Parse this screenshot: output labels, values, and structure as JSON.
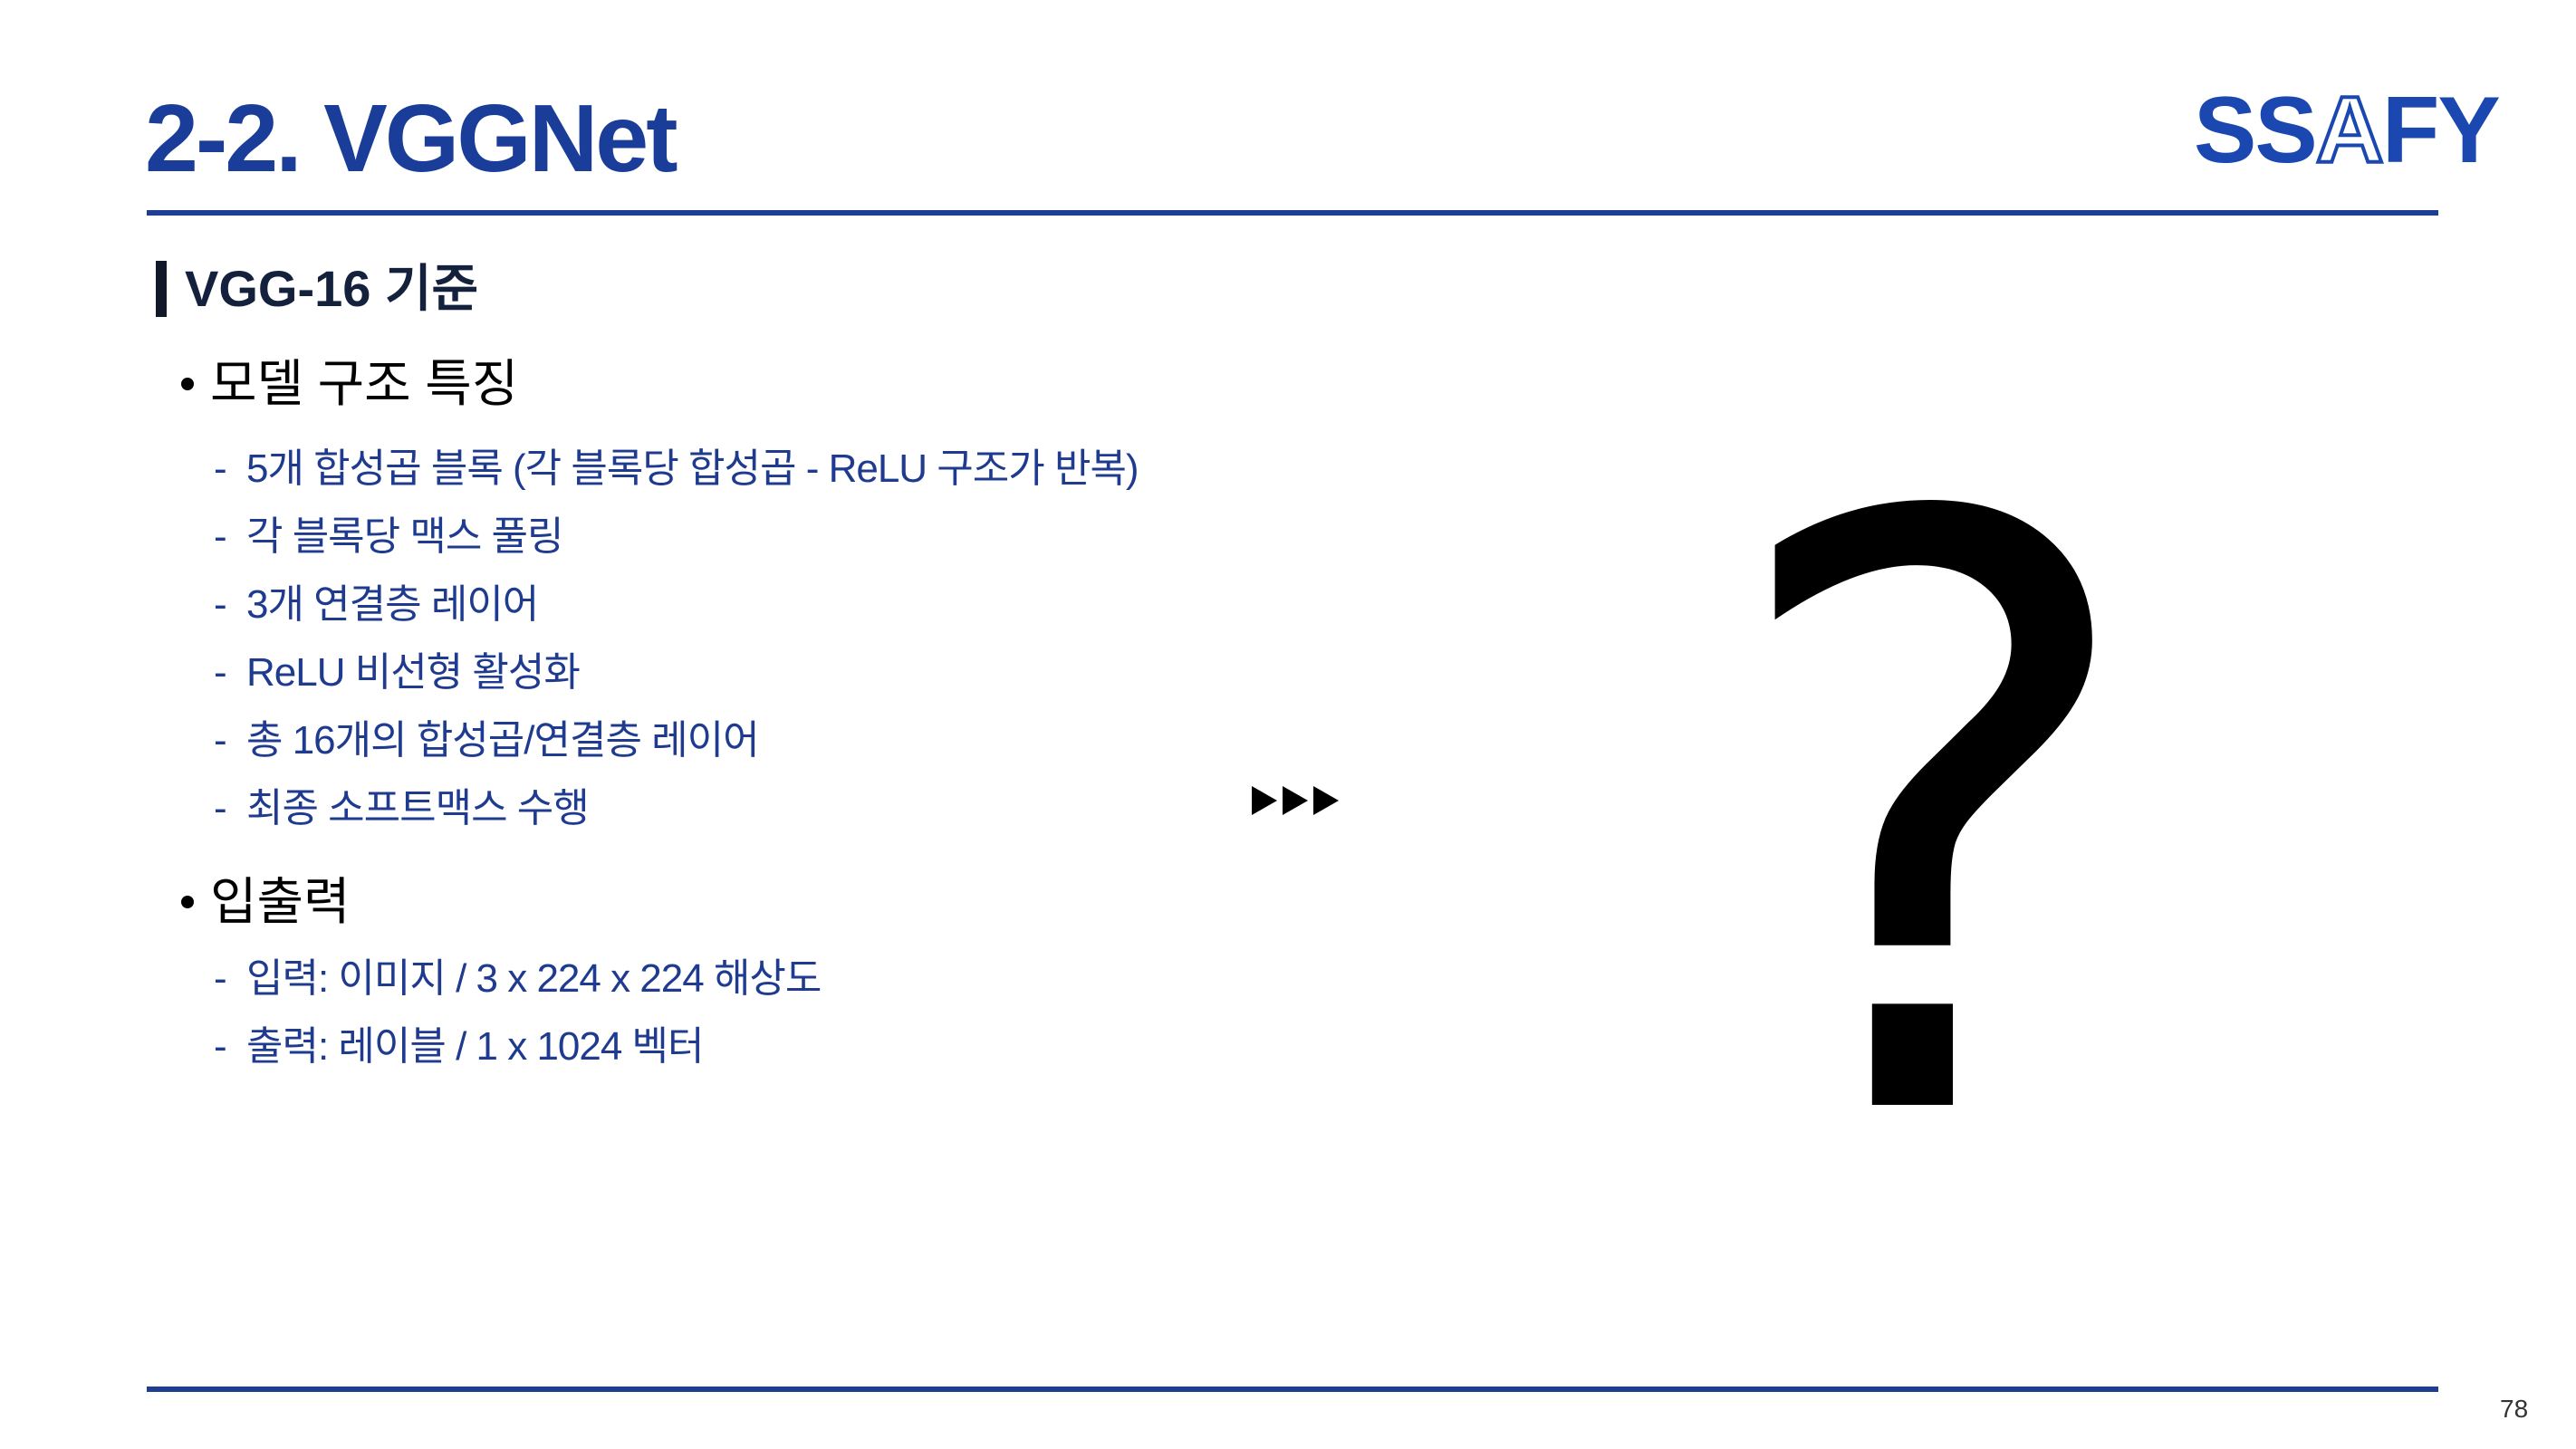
{
  "slide": {
    "title": "2-2. VGGNet",
    "logo": {
      "part1": "SS",
      "part2": "A",
      "part3": "FY"
    },
    "section_heading": "VGG-16 기준",
    "bullets": [
      {
        "label": "모델 구조 특징",
        "items": [
          "5개 합성곱 블록 (각 블록당 합성곱 - ReLU 구조가 반복)",
          "각 블록당 맥스 풀링",
          "3개 연결층 레이어",
          "ReLU 비선형 활성화",
          "총 16개의 합성곱/연결층 레이어",
          "최종 소프트맥스 수행"
        ]
      },
      {
        "label": "입출력",
        "items": [
          "입력: 이미지 / 3 x 224 x 224 해상도",
          "출력: 레이블 / 1 x 1024 벡터"
        ]
      }
    ],
    "dash": "-",
    "question_mark": "?",
    "page_number": "78"
  },
  "colors": {
    "title": "#1a3d9a",
    "rule": "#1e3e94",
    "sub_text": "#1f3b8f",
    "logo": "#1a47b0"
  },
  "icons": {
    "arrows": "triple-play-arrow-icon"
  }
}
